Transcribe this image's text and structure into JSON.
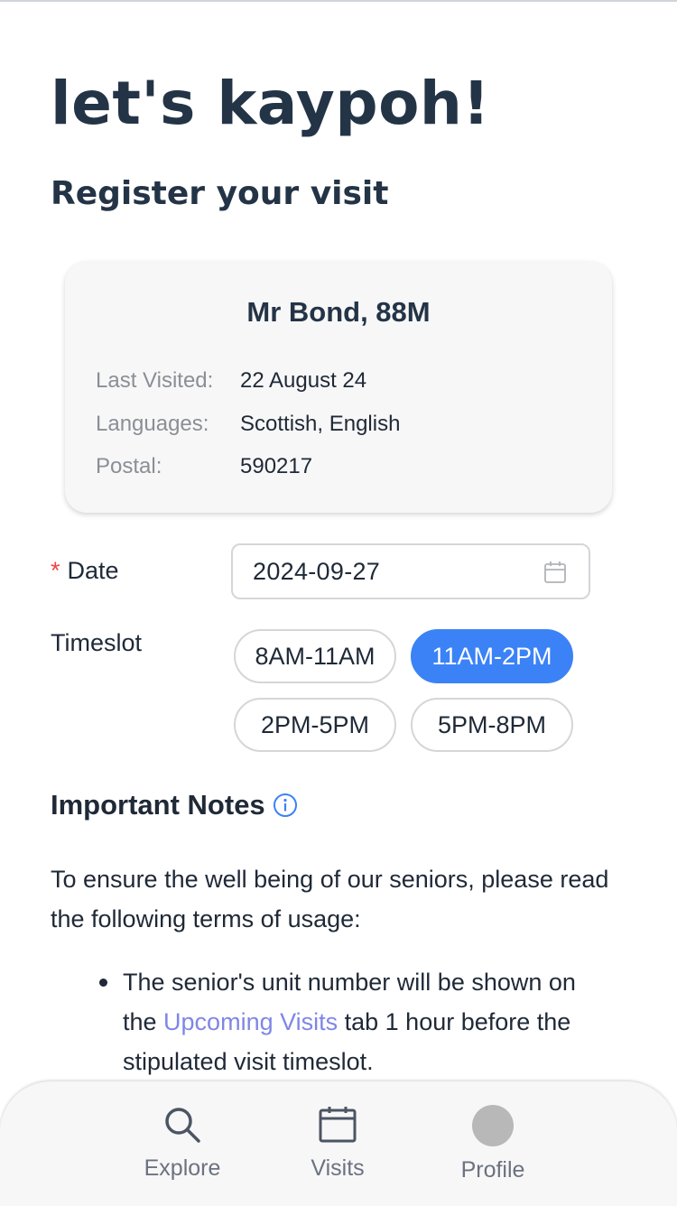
{
  "header": {
    "app_title": "let's kaypoh!",
    "subtitle": "Register your visit"
  },
  "senior_card": {
    "name": "Mr Bond, 88M",
    "rows": [
      {
        "label": "Last Visited:",
        "value": "22 August 24"
      },
      {
        "label": "Languages:",
        "value": "Scottish, English"
      },
      {
        "label": "Postal:",
        "value": "590217"
      }
    ]
  },
  "form": {
    "date": {
      "required_mark": "*",
      "label": "Date",
      "value": "2024-09-27",
      "icon": "calendar-icon"
    },
    "timeslot": {
      "label": "Timeslot",
      "options": [
        "8AM-11AM",
        "11AM-2PM",
        "2PM-5PM",
        "5PM-8PM"
      ],
      "selected": "11AM-2PM"
    }
  },
  "notes": {
    "heading": "Important Notes",
    "heading_icon": "info-icon",
    "intro": "To ensure the well being of our seniors, please read the following terms of usage:",
    "items": [
      {
        "before": "The senior's unit number will be shown on the ",
        "link": "Upcoming Visits",
        "after": " tab 1 hour before the stipulated visit timeslot."
      }
    ]
  },
  "bottom_nav": {
    "items": [
      {
        "label": "Explore",
        "icon": "search-icon"
      },
      {
        "label": "Visits",
        "icon": "calendar-icon"
      },
      {
        "label": "Profile",
        "icon": "avatar"
      }
    ]
  },
  "colors": {
    "accent": "#3b82f6",
    "title": "#243447",
    "link": "#7f86e6",
    "required": "#ef4444",
    "card_bg": "#f7f7f7"
  }
}
